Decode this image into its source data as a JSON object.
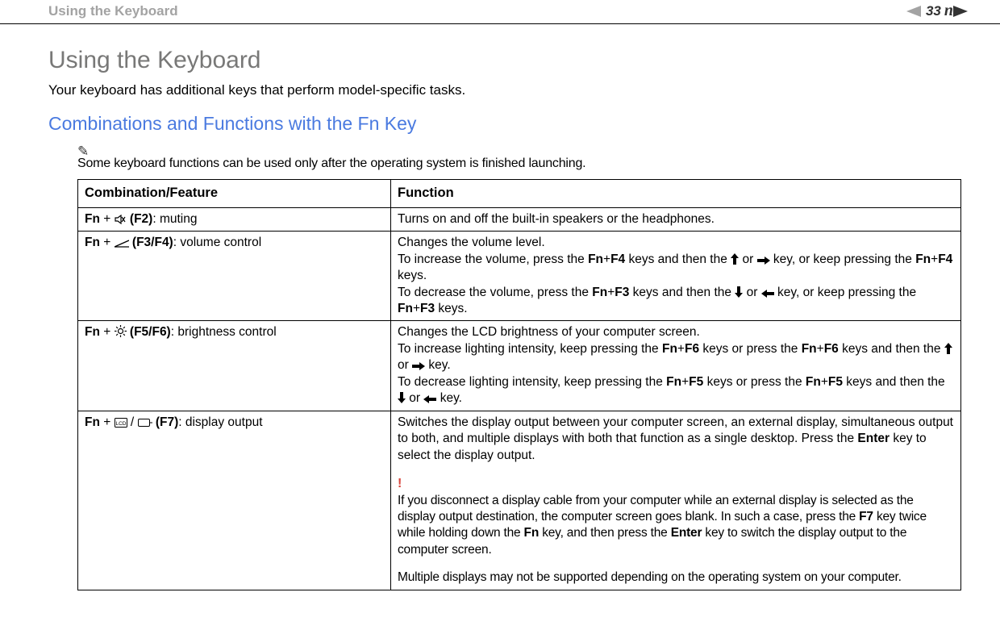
{
  "header": {
    "breadcrumb": "Using the Keyboard",
    "page_number": "33"
  },
  "page": {
    "title": "Using the Keyboard",
    "intro": "Your keyboard has additional keys that perform model-specific tasks.",
    "subtitle": "Combinations and Functions with the Fn Key",
    "note": "Some keyboard functions can be used only after the operating system is finished launching."
  },
  "table": {
    "headers": {
      "col1": "Combination/Feature",
      "col2": "Function"
    },
    "rows": [
      {
        "combo_prefix": "Fn",
        "combo_plus": " + ",
        "combo_icon": "mute",
        "combo_key": " (F2)",
        "combo_label": ": muting",
        "func": "Turns on and off the built-in speakers or the headphones."
      },
      {
        "combo_prefix": "Fn",
        "combo_plus": " + ",
        "combo_icon": "volume",
        "combo_key": " (F3/F4)",
        "combo_label": ": volume control",
        "func_p1": "Changes the volume level.",
        "func_p2a": "To increase the volume, press the ",
        "func_p2b": "Fn",
        "func_p2c": "+",
        "func_p2d": "F4",
        "func_p2e": " keys and then the ",
        "func_p2f": " or ",
        "func_p2g": " key, or keep pressing the ",
        "func_p2h": "Fn",
        "func_p2i": "+",
        "func_p2j": "F4",
        "func_p2k": " keys.",
        "func_p3a": "To decrease the volume, press the ",
        "func_p3b": "Fn",
        "func_p3c": "+",
        "func_p3d": "F3",
        "func_p3e": " keys and then the ",
        "func_p3f": " or ",
        "func_p3g": " key, or keep pressing the ",
        "func_p3h": "Fn",
        "func_p3i": "+",
        "func_p3j": "F3",
        "func_p3k": " keys."
      },
      {
        "combo_prefix": "Fn",
        "combo_plus": " + ",
        "combo_icon": "brightness",
        "combo_key": " (F5/F6)",
        "combo_label": ": brightness control",
        "func_p1": "Changes the LCD brightness of your computer screen.",
        "func_p2a": "To increase lighting intensity, keep pressing the ",
        "func_p2b": "Fn",
        "func_p2c": "+",
        "func_p2d": "F6",
        "func_p2e": " keys or press the ",
        "func_p2f": "Fn",
        "func_p2g": "+",
        "func_p2h": "F6",
        "func_p2i": " keys and then the ",
        "func_p2j": " or ",
        "func_p2k": " key.",
        "func_p3a": "To decrease lighting intensity, keep pressing the ",
        "func_p3b": "Fn",
        "func_p3c": "+",
        "func_p3d": "F5",
        "func_p3e": " keys or press the ",
        "func_p3f": "Fn",
        "func_p3g": "+",
        "func_p3h": "F5",
        "func_p3i": " keys and then the ",
        "func_p3j": " or ",
        "func_p3k": " key."
      },
      {
        "combo_prefix": "Fn",
        "combo_plus": " + ",
        "combo_icon": "display",
        "combo_key": " (F7)",
        "combo_label": ": display output",
        "func_p1a": "Switches the display output between your computer screen, an external display, simultaneous output to both, and multiple displays with both that function as a single desktop. Press the ",
        "func_p1b": "Enter",
        "func_p1c": " key to select the display output.",
        "warn_mark": "!",
        "func_p2a": "If you disconnect a display cable from your computer while an external display is selected as the display output destination, the computer screen goes blank. In such a case, press the ",
        "func_p2b": "F7",
        "func_p2c": " key twice while holding down the ",
        "func_p2d": "Fn",
        "func_p2e": " key, and then press the ",
        "func_p2f": "Enter",
        "func_p2g": " key to switch the display output to the computer screen.",
        "func_p3": "Multiple displays may not be supported depending on the operating system on your computer."
      }
    ]
  }
}
